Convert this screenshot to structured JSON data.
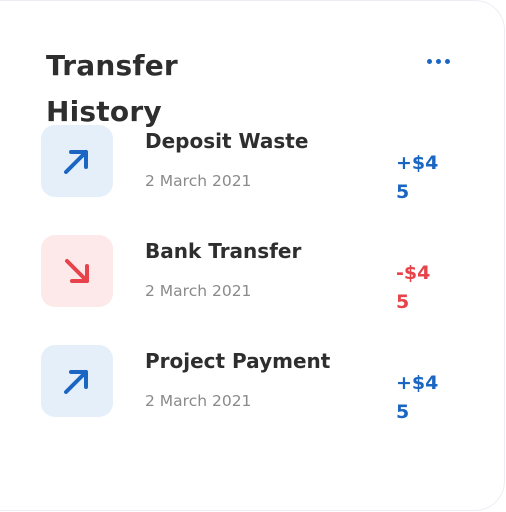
{
  "header": {
    "title": "Transfer History",
    "more_icon": "more-horizontal-icon"
  },
  "colors": {
    "accent_blue": "#1a66c2",
    "accent_red": "#e8434a",
    "icon_bg_blue": "#e5effa",
    "icon_bg_red": "#fde9ea"
  },
  "transactions": [
    {
      "name": "Deposit Waste",
      "date": "2 March 2021",
      "amount": "+$45",
      "direction": "incoming",
      "icon": "arrow-up-right-icon"
    },
    {
      "name": "Bank Transfer",
      "date": "2 March 2021",
      "amount": "-$45",
      "direction": "outgoing",
      "icon": "arrow-down-right-icon"
    },
    {
      "name": "Project Payment",
      "date": "2 March 2021",
      "amount": "+$45",
      "direction": "incoming",
      "icon": "arrow-up-right-icon"
    }
  ]
}
